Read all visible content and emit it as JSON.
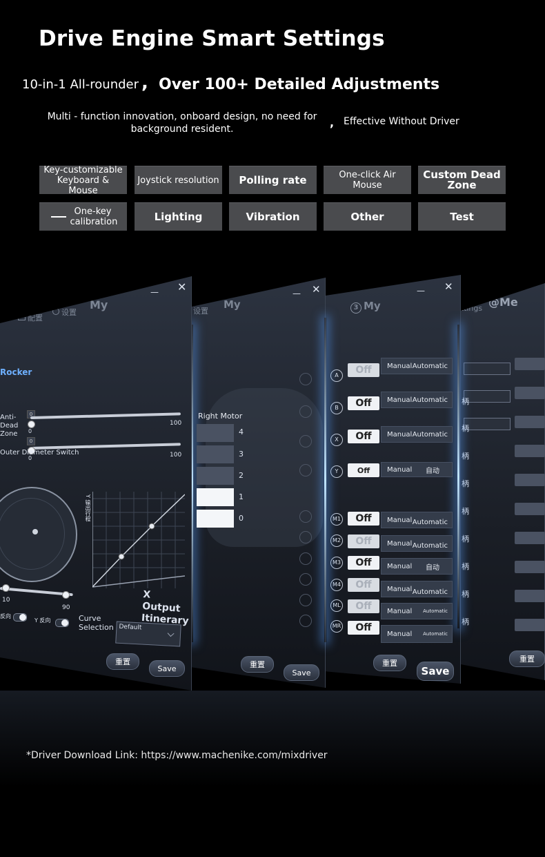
{
  "header": {
    "title": "Drive Engine Smart Settings",
    "sub_left": "10-in-1 All-rounder",
    "comma": ",",
    "sub_right": "Over 100+ Detailed Adjustments",
    "desc_left": "Multi - function innovation, onboard design, no need for background resident.",
    "desc_comma": ",",
    "desc_right": "Effective Without Driver"
  },
  "features": [
    "Key-customizable Keyboard & Mouse",
    "Joystick resolution",
    "Polling rate",
    "One-click Air Mouse",
    "Custom Dead Zone",
    "One-key calibration",
    "Lighting",
    "Vibration",
    "Other",
    "Test"
  ],
  "panel1": {
    "nav_config": "配置",
    "nav_settings": "设置",
    "nav_my": "My",
    "minimize": "—",
    "close": "✕",
    "section": "Rocker",
    "anti_dead_zone": "Anti-Dead Zone",
    "outer_diameter": "Outer Diameter Switch",
    "slider_min": "0",
    "slider_max": "100",
    "box_value": "0",
    "range_low": "10",
    "range_high": "90",
    "y_axis_label": "Y 输出行程",
    "x_output": "X Output Itinerary",
    "x_reverse": "反向",
    "y_reverse": "Y 反向",
    "curve_selection": "Curve Selection",
    "curve_default": "Default",
    "reset": "重置",
    "save": "Save"
  },
  "panel2": {
    "nav_settings": "设置",
    "nav_my": "My",
    "minimize": "—",
    "close": "✕",
    "right_motor": "Right Motor",
    "levels": [
      "4",
      "3",
      "2",
      "1",
      "0"
    ],
    "reset": "重置",
    "save": "Save"
  },
  "panel3": {
    "nav_my": "My",
    "minimize": "—",
    "close": "✕",
    "rows": [
      {
        "key": "A",
        "off": "Off",
        "manual": "Manual",
        "auto": "Automatic"
      },
      {
        "key": "B",
        "off": "Off",
        "manual": "Manual",
        "auto": "Automatic"
      },
      {
        "key": "X",
        "off": "Off",
        "manual": "Manual",
        "auto": "Automatic"
      },
      {
        "key": "Y",
        "off": "Off",
        "manual": "Manual",
        "auto": "自动"
      },
      {
        "key": "M1",
        "off": "Off",
        "manual": "Manual",
        "auto": "Automatic"
      },
      {
        "key": "M2",
        "off": "Off",
        "manual": "Manual",
        "auto": "Automatic"
      },
      {
        "key": "M3",
        "off": "Off",
        "manual": "Manual",
        "auto": "自动"
      },
      {
        "key": "M4",
        "off": "Off",
        "manual": "Manual",
        "auto": "Automatic"
      },
      {
        "key": "ML",
        "off": "Off",
        "manual": "Manual",
        "auto": "Automatic"
      },
      {
        "key": "MR",
        "off": "Off",
        "manual": "Manual",
        "auto": "Automatic"
      }
    ],
    "reset": "重置",
    "save": "Save"
  },
  "panel4": {
    "nav_settings": "Settings",
    "nav_me": "@Me",
    "handle_label": "柄",
    "reset": "重置"
  },
  "footer": {
    "link": "*Driver Download Link: https://www.machenike.com/mixdriver"
  }
}
